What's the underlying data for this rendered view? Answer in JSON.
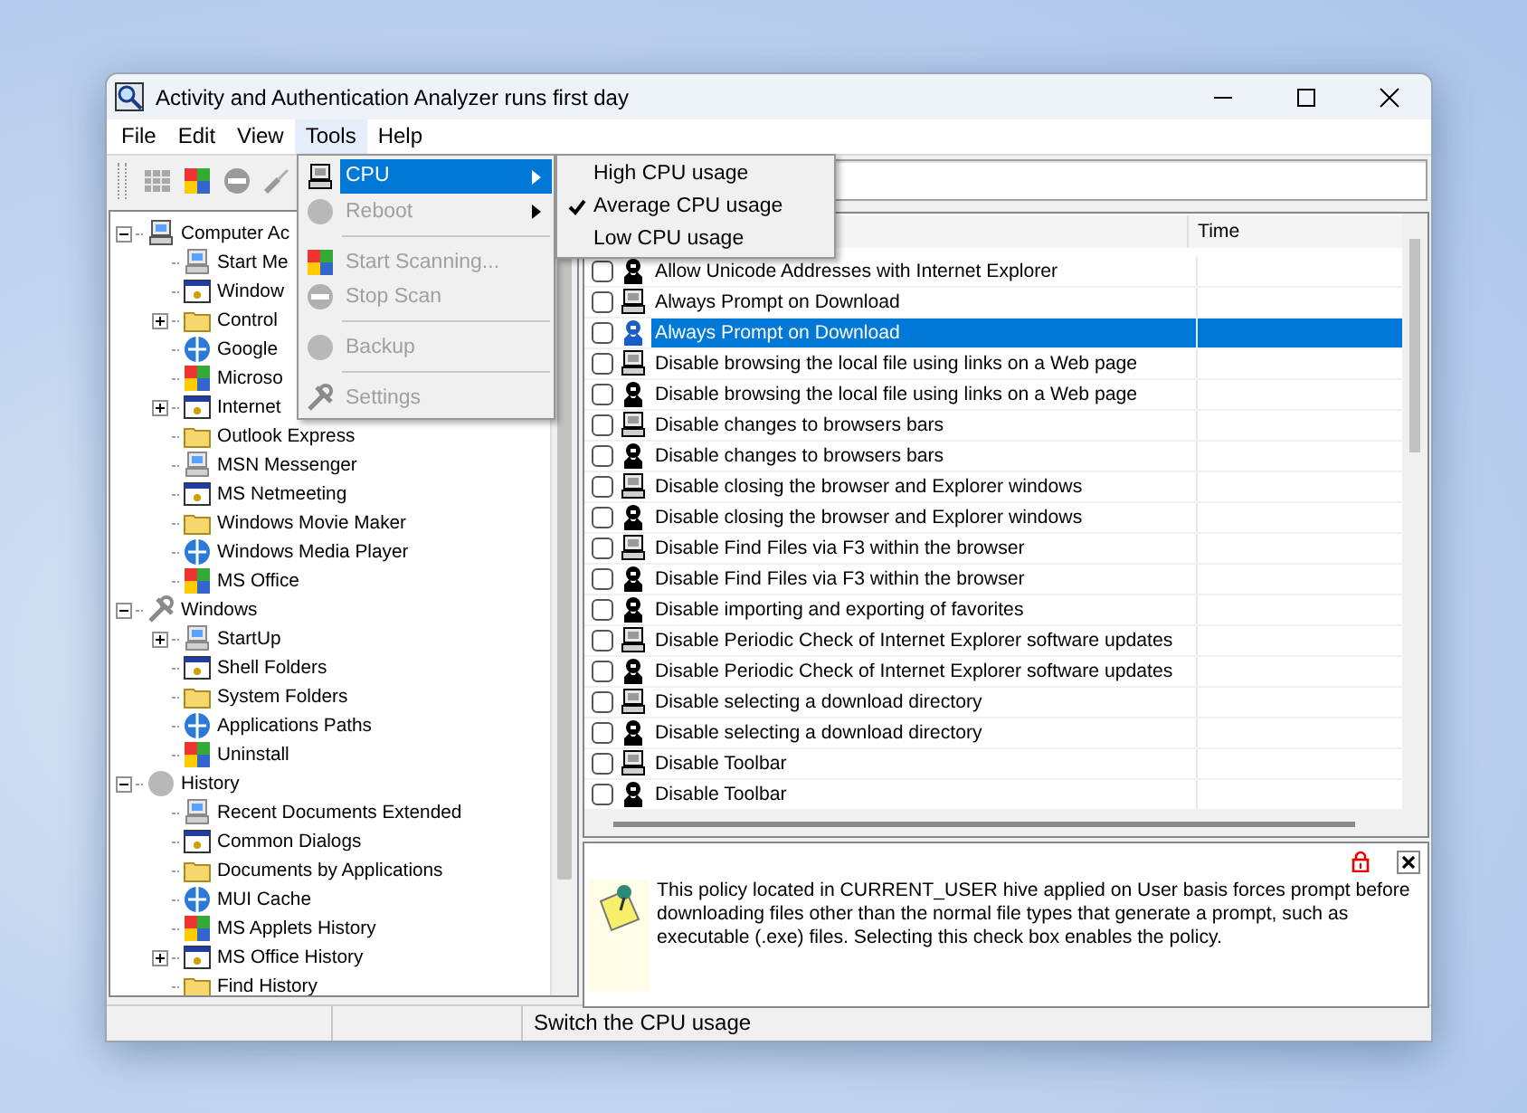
{
  "window": {
    "title": "Activity and Authentication Analyzer runs first day"
  },
  "menu_bar": [
    {
      "label": "File",
      "selected": false
    },
    {
      "label": "Edit",
      "selected": false
    },
    {
      "label": "View",
      "selected": false
    },
    {
      "label": "Tools",
      "selected": true
    },
    {
      "label": "Help",
      "selected": false
    }
  ],
  "tools_menu": [
    {
      "kind": "item",
      "label": "CPU",
      "selected": true,
      "disabled": false,
      "submenu": true
    },
    {
      "kind": "item",
      "label": "Reboot",
      "selected": false,
      "disabled": true,
      "submenu": true
    },
    {
      "kind": "separator"
    },
    {
      "kind": "item",
      "label": "Start Scanning...",
      "selected": false,
      "disabled": true,
      "submenu": false
    },
    {
      "kind": "item",
      "label": "Stop Scan",
      "selected": false,
      "disabled": true,
      "submenu": false
    },
    {
      "kind": "separator"
    },
    {
      "kind": "item",
      "label": "Backup",
      "selected": false,
      "disabled": true,
      "submenu": false
    },
    {
      "kind": "separator"
    },
    {
      "kind": "item",
      "label": "Settings",
      "selected": false,
      "disabled": true,
      "submenu": false
    }
  ],
  "cpu_submenu": [
    {
      "label": "High CPU usage",
      "checked": false
    },
    {
      "label": "Average CPU usage",
      "checked": true
    },
    {
      "label": "Low CPU usage",
      "checked": false
    }
  ],
  "tree": [
    {
      "label": "Computer Ac",
      "expanded": true,
      "children": [
        {
          "label": "Start Me"
        },
        {
          "label": "Window"
        },
        {
          "label": "Control",
          "expanded": false
        },
        {
          "label": "Google"
        },
        {
          "label": "Microso"
        },
        {
          "label": "Internet",
          "expanded": false
        },
        {
          "label": "Outlook Express"
        },
        {
          "label": "MSN Messenger"
        },
        {
          "label": "MS Netmeeting"
        },
        {
          "label": "Windows Movie Maker"
        },
        {
          "label": "Windows Media Player"
        },
        {
          "label": "MS Office"
        }
      ]
    },
    {
      "label": "Windows",
      "expanded": true,
      "children": [
        {
          "label": "StartUp",
          "expanded": false
        },
        {
          "label": "Shell Folders"
        },
        {
          "label": "System Folders"
        },
        {
          "label": "Applications Paths"
        },
        {
          "label": "Uninstall"
        }
      ]
    },
    {
      "label": "History",
      "expanded": true,
      "children": [
        {
          "label": "Recent Documents Extended"
        },
        {
          "label": "Common Dialogs"
        },
        {
          "label": "Documents by Applications"
        },
        {
          "label": "MUI Cache"
        },
        {
          "label": "MS Applets History"
        },
        {
          "label": "MS Office History",
          "expanded": false
        },
        {
          "label": "Find History"
        }
      ]
    }
  ],
  "list": {
    "columns": [
      {
        "label": "Time"
      }
    ],
    "rows": [
      {
        "kind": "user",
        "text": "Allow Unicode Addresses with Internet Explorer",
        "checked": false,
        "selected": false
      },
      {
        "kind": "machine",
        "text": "Always Prompt on Download",
        "checked": false,
        "selected": false
      },
      {
        "kind": "user",
        "text": "Always Prompt on Download",
        "checked": false,
        "selected": true
      },
      {
        "kind": "machine",
        "text": "Disable browsing the local file using links on a Web page",
        "checked": false,
        "selected": false
      },
      {
        "kind": "user",
        "text": "Disable browsing the local file using links on a Web page",
        "checked": false,
        "selected": false
      },
      {
        "kind": "machine",
        "text": "Disable changes to browsers bars",
        "checked": false,
        "selected": false
      },
      {
        "kind": "user",
        "text": "Disable changes to browsers bars",
        "checked": false,
        "selected": false
      },
      {
        "kind": "machine",
        "text": "Disable closing the browser and Explorer windows",
        "checked": false,
        "selected": false
      },
      {
        "kind": "user",
        "text": "Disable closing the browser and Explorer windows",
        "checked": false,
        "selected": false
      },
      {
        "kind": "machine",
        "text": "Disable Find Files via F3 within the browser",
        "checked": false,
        "selected": false
      },
      {
        "kind": "user",
        "text": "Disable Find Files via F3 within the browser",
        "checked": false,
        "selected": false
      },
      {
        "kind": "user",
        "text": "Disable importing and exporting of favorites",
        "checked": false,
        "selected": false
      },
      {
        "kind": "machine",
        "text": "Disable Periodic Check of Internet Explorer software updates",
        "checked": false,
        "selected": false
      },
      {
        "kind": "user",
        "text": "Disable Periodic Check of Internet Explorer software updates",
        "checked": false,
        "selected": false
      },
      {
        "kind": "machine",
        "text": "Disable selecting a download directory",
        "checked": false,
        "selected": false
      },
      {
        "kind": "user",
        "text": "Disable selecting a download directory",
        "checked": false,
        "selected": false
      },
      {
        "kind": "machine",
        "text": "Disable Toolbar",
        "checked": false,
        "selected": false
      },
      {
        "kind": "user",
        "text": "Disable Toolbar",
        "checked": false,
        "selected": false
      }
    ]
  },
  "info_panel": {
    "text": "This policy located in CURRENT_USER hive applied on User basis forces prompt before downloading files other than the normal file types that generate a prompt, such as executable (.exe) files.  Selecting this check box enables the policy."
  },
  "status_bar": {
    "text": "Switch the CPU usage"
  }
}
